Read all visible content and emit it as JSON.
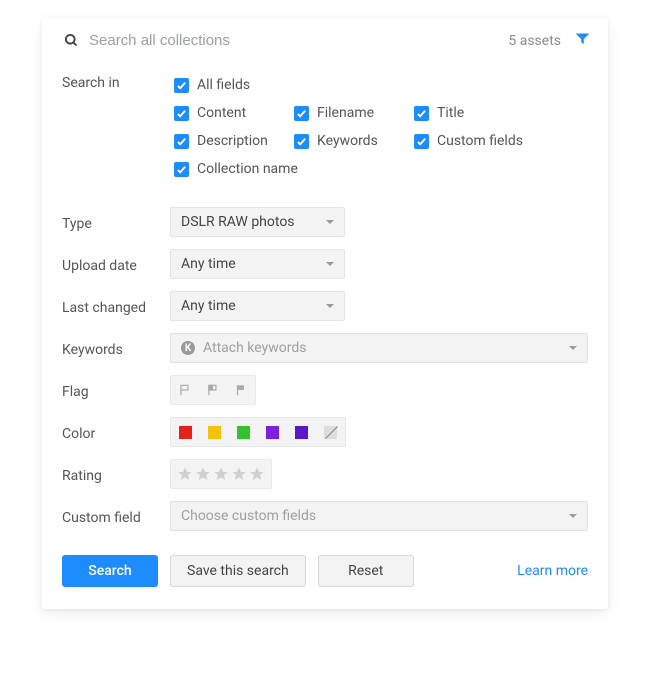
{
  "search": {
    "placeholder": "Search all collections",
    "value": "",
    "asset_count": "5 assets"
  },
  "search_in": {
    "label": "Search in",
    "options": {
      "all": "All fields",
      "content": "Content",
      "filename": "Filename",
      "title": "Title",
      "description": "Description",
      "keywords": "Keywords",
      "custom_fields": "Custom fields",
      "collection_name": "Collection name"
    }
  },
  "type": {
    "label": "Type",
    "value": "DSLR RAW photos"
  },
  "upload_date": {
    "label": "Upload date",
    "value": "Any time"
  },
  "last_changed": {
    "label": "Last changed",
    "value": "Any time"
  },
  "keywords": {
    "label": "Keywords",
    "placeholder": "Attach keywords"
  },
  "flag": {
    "label": "Flag"
  },
  "color": {
    "label": "Color",
    "swatches": [
      "#e32219",
      "#f4c20d",
      "#34c22e",
      "#7b1fe0",
      "#5a17c7"
    ]
  },
  "rating": {
    "label": "Rating"
  },
  "custom_field": {
    "label": "Custom field",
    "placeholder": "Choose custom fields"
  },
  "buttons": {
    "search": "Search",
    "save": "Save this search",
    "reset": "Reset",
    "learn_more": "Learn more"
  }
}
